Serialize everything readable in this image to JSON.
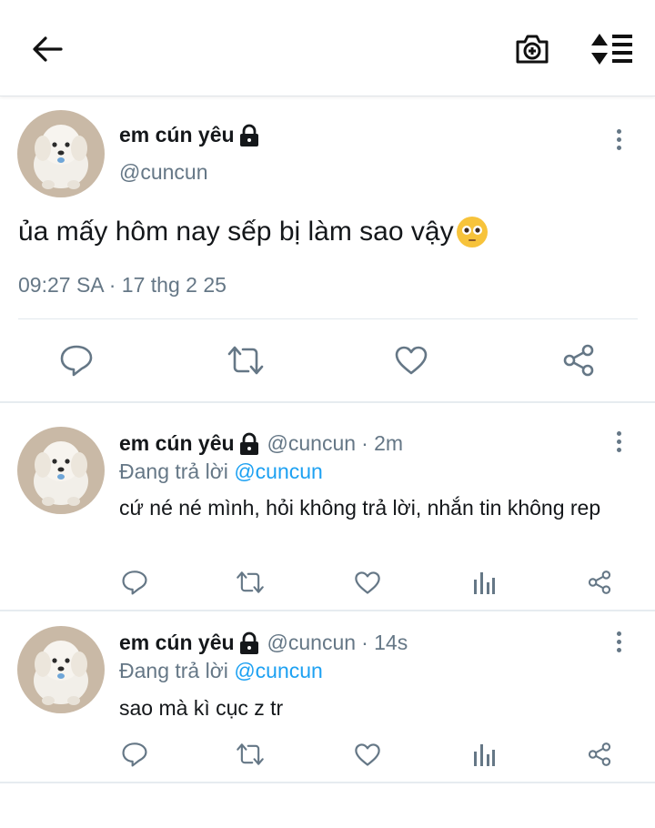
{
  "colors": {
    "accent": "#1da1f2",
    "muted": "#657786",
    "text": "#14171a"
  },
  "topbar": {
    "back_icon": "arrow-left-icon",
    "camera_icon": "camera-plus-icon",
    "sort_icon": "sort-lines-icon"
  },
  "main_tweet": {
    "display_name": "em cún yêu",
    "handle": "@cuncun",
    "text": "ủa mấy hôm nay sếp bị làm sao vậy",
    "emoji": "🙂",
    "timestamp": "09:27 SA · 17 thg 2 25",
    "actions": [
      "reply-icon",
      "retweet-icon",
      "like-icon",
      "share-icon"
    ]
  },
  "replies": [
    {
      "display_name": "em cún yêu",
      "handle": "@cuncun",
      "time": "· 2m",
      "replying_prefix": "Đang trả lời",
      "replying_to": "@cuncun",
      "text": "cứ né né mình, hỏi không trả lời, nhắn tin không rep"
    },
    {
      "display_name": "em cún yêu",
      "handle": "@cuncun",
      "time": "· 14s",
      "replying_prefix": "Đang trả lời",
      "replying_to": "@cuncun",
      "text": "sao mà kì cục z tr"
    }
  ]
}
